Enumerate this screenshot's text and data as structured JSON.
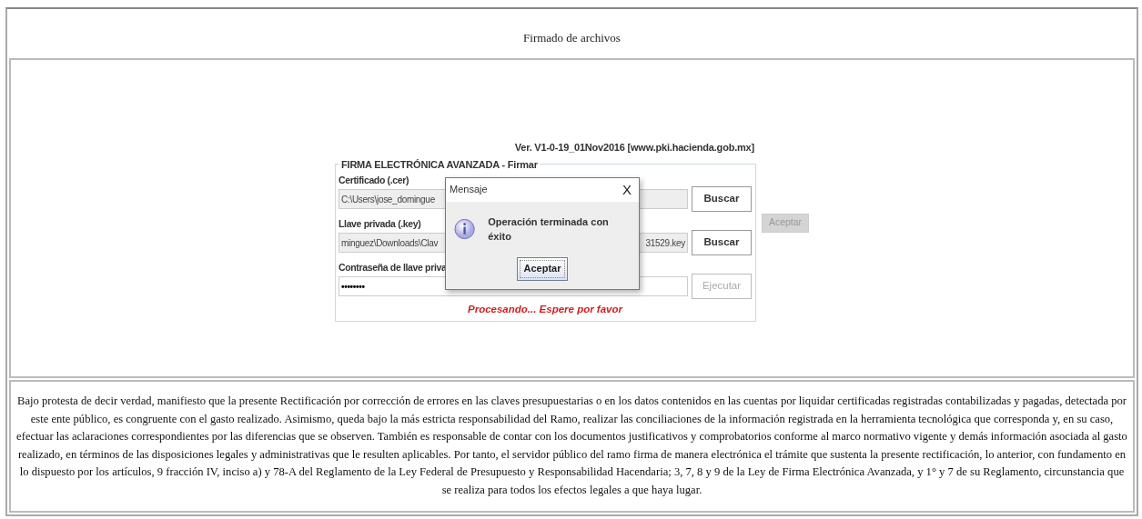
{
  "page_title": "Firmado de archivos",
  "applet": {
    "version": "Ver. V1-0-19_01Nov2016 [www.pki.hacienda.gob.mx]",
    "legend": "FIRMA ELECTRÓNICA AVANZADA - Firmar",
    "fields": [
      {
        "label": "Certificado (.cer)",
        "value": "C:\\Users\\jose_domingue",
        "kind": "text",
        "button": {
          "label": "Buscar",
          "disabled": false
        }
      },
      {
        "label": "Llave privada (.key)",
        "value": "minguez\\Downloads\\Clav",
        "value_tail": "31529.key",
        "kind": "text",
        "button": {
          "label": "Buscar",
          "disabled": false
        }
      },
      {
        "label": "Contraseña de llave priva",
        "value": "••••••••",
        "kind": "password",
        "button": {
          "label": "Ejecutar",
          "disabled": true
        }
      }
    ],
    "status": "Procesando... Espere por favor"
  },
  "side_button": {
    "label": "Aceptar",
    "disabled": true
  },
  "dialog": {
    "title": "Mensaje",
    "close": "X",
    "message": "Operación terminada con éxito",
    "button": "Aceptar"
  },
  "declaration": "Bajo protesta de decir verdad, manifiesto que la presente Rectificación por corrección de errores en las claves presupuestarias o en los datos contenidos en las cuentas por liquidar certificadas registradas contabilizadas y pagadas, detectada por este ente público, es congruente con el gasto realizado. Asimismo, queda bajo la más estricta responsabilidad del Ramo, realizar las conciliaciones de la información registrada en la herramienta tecnológica que corresponda y, en su caso, efectuar las aclaraciones correspondientes por las diferencias que se observen. También es responsable de contar con los documentos justificativos y comprobatorios conforme al marco normativo vigente y demás información asociada al gasto realizado, en términos de las disposiciones legales y administrativas que le resulten aplicables. Por tanto, el servidor público del ramo firma de manera electrónica el trámite que sustenta la presente rectificación, lo anterior, con fundamento en lo dispuesto por los artículos, 9 fracción IV, inciso a) y 78-A del Reglamento de la Ley Federal de Presupuesto y Responsabilidad Hacendaria; 3, 7, 8 y 9 de la Ley de Firma Electrónica Avanzada, y 1° y 7 de su Reglamento, circunstancia que se realiza para todos los efectos legales a que haya lugar."
}
